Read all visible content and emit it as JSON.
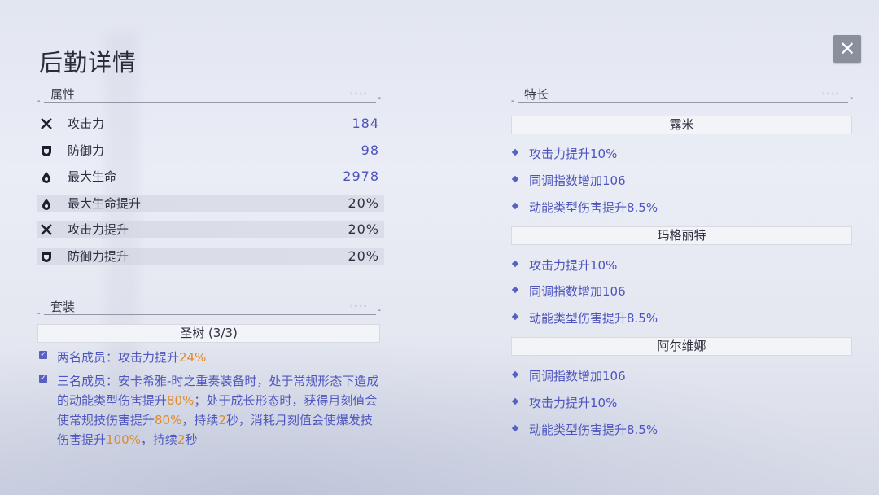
{
  "title": "后勤详情",
  "close_glyph": "✕",
  "attributes": {
    "header": "属性",
    "rows": [
      {
        "icon": "crossed-swords-icon",
        "name": "攻击力",
        "value": "184"
      },
      {
        "icon": "shield-icon",
        "name": "防御力",
        "value": "98"
      },
      {
        "icon": "drop-icon",
        "name": "最大生命",
        "value": "2978"
      },
      {
        "icon": "drop-icon",
        "name": "最大生命提升",
        "value": "20%"
      },
      {
        "icon": "crossed-swords-icon",
        "name": "攻击力提升",
        "value": "20%"
      },
      {
        "icon": "shield-icon",
        "name": "防御力提升",
        "value": "20%"
      }
    ]
  },
  "set": {
    "header": "套装",
    "name": "圣树 (3/3)",
    "two_piece": {
      "prefix": "两名成员：攻击力提升",
      "value": "24%"
    },
    "three_piece": {
      "p1": "三名成员：安卡希雅-时之重奏装备时，处于常规形态下造成的动能类型伤害提升",
      "v1": "80%",
      "p2": "；处于成长形态时，获得月刻值会使常规技伤害提升",
      "v2": "80%",
      "p3": "，持续",
      "v3": "2",
      "p4": "秒，消耗月刻值会使爆发技伤害提升",
      "v4": "100%",
      "p5": "，持续",
      "v5": "2",
      "p6": "秒"
    }
  },
  "specialty": {
    "header": "特长",
    "groups": [
      {
        "name": "露米",
        "items": [
          "攻击力提升10%",
          "同调指数增加106",
          "动能类型伤害提升8.5%"
        ]
      },
      {
        "name": "玛格丽特",
        "items": [
          "攻击力提升10%",
          "同调指数增加106",
          "动能类型伤害提升8.5%"
        ]
      },
      {
        "name": "阿尔维娜",
        "items": [
          "同调指数增加106",
          "攻击力提升10%",
          "动能类型伤害提升8.5%"
        ]
      }
    ]
  },
  "colors": {
    "accent": "#4d54bf",
    "highlight": "#e08a2a",
    "close_bg": "#8a8f9d"
  }
}
